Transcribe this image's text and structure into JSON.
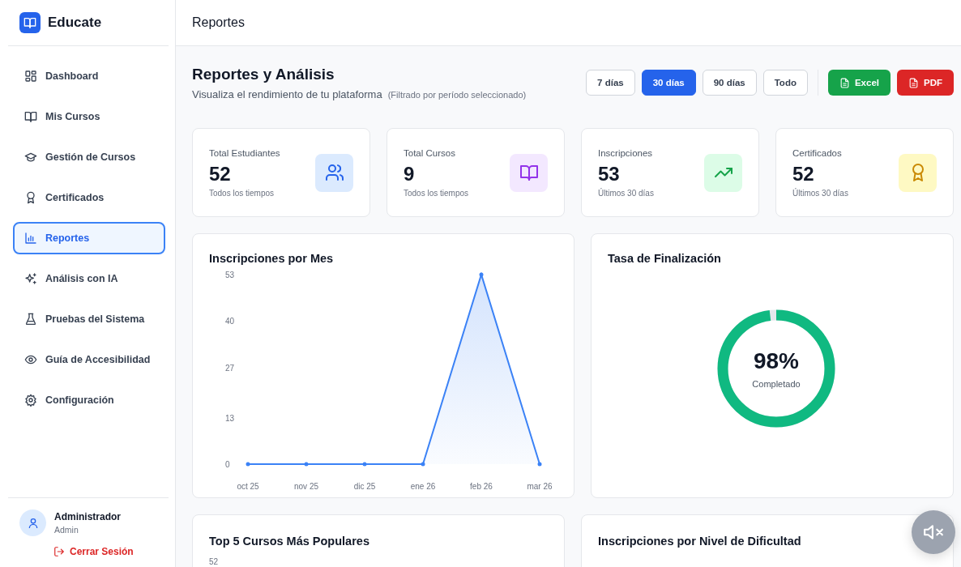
{
  "brand": {
    "name": "Educate"
  },
  "header": {
    "title": "Reportes"
  },
  "sidebar": {
    "items": [
      {
        "label": "Dashboard",
        "selected": false
      },
      {
        "label": "Mis Cursos",
        "selected": false
      },
      {
        "label": "Gestión de Cursos",
        "selected": false
      },
      {
        "label": "Certificados",
        "selected": false
      },
      {
        "label": "Reportes",
        "selected": true
      },
      {
        "label": "Análisis con IA",
        "selected": false
      },
      {
        "label": "Pruebas del Sistema",
        "selected": false
      },
      {
        "label": "Guía de Accesibilidad",
        "selected": false
      },
      {
        "label": "Configuración",
        "selected": false
      }
    ],
    "user": {
      "name": "Administrador",
      "role": "Admin"
    },
    "logout": "Cerrar Sesión"
  },
  "page": {
    "title": "Reportes y Análisis",
    "subtitle": "Visualiza el rendimiento de tu plataforma",
    "filter_note": "(Filtrado por período seleccionado)"
  },
  "periods": [
    {
      "label": "7 días",
      "selected": false
    },
    {
      "label": "30 días",
      "selected": true
    },
    {
      "label": "90 días",
      "selected": false
    },
    {
      "label": "Todo",
      "selected": false
    }
  ],
  "exports": [
    {
      "label": "Excel",
      "kind": "excel"
    },
    {
      "label": "PDF",
      "kind": "pdf"
    }
  ],
  "stats": [
    {
      "label": "Total Estudiantes",
      "value": "52",
      "note": "Todos los tiempos"
    },
    {
      "label": "Total Cursos",
      "value": "9",
      "note": "Todos los tiempos"
    },
    {
      "label": "Inscripciones",
      "value": "53",
      "note": "Últimos 30 días"
    },
    {
      "label": "Certificados",
      "value": "52",
      "note": "Últimos 30 días"
    }
  ],
  "enrollments_chart": {
    "title": "Inscripciones por Mes",
    "chart_data": {
      "type": "area",
      "categories": [
        "oct 25",
        "nov 25",
        "dic 25",
        "ene 26",
        "feb 26",
        "mar 26"
      ],
      "series": [
        {
          "color": "#3b82f6",
          "values": [
            0,
            0,
            0,
            0,
            53,
            0
          ]
        }
      ],
      "ylim": [
        0,
        53
      ],
      "yticks": [
        0,
        13,
        27,
        40,
        53
      ]
    }
  },
  "completion": {
    "title": "Tasa de Finalización",
    "value": "98%",
    "caption": "Completado",
    "level": 0.98
  },
  "top_courses": {
    "title": "Top 5 Cursos Más Populares",
    "axis_tick": "52"
  },
  "difficulty": {
    "title": "Inscripciones por Nivel de Dificultad"
  },
  "mute_button": {
    "muted": true
  }
}
